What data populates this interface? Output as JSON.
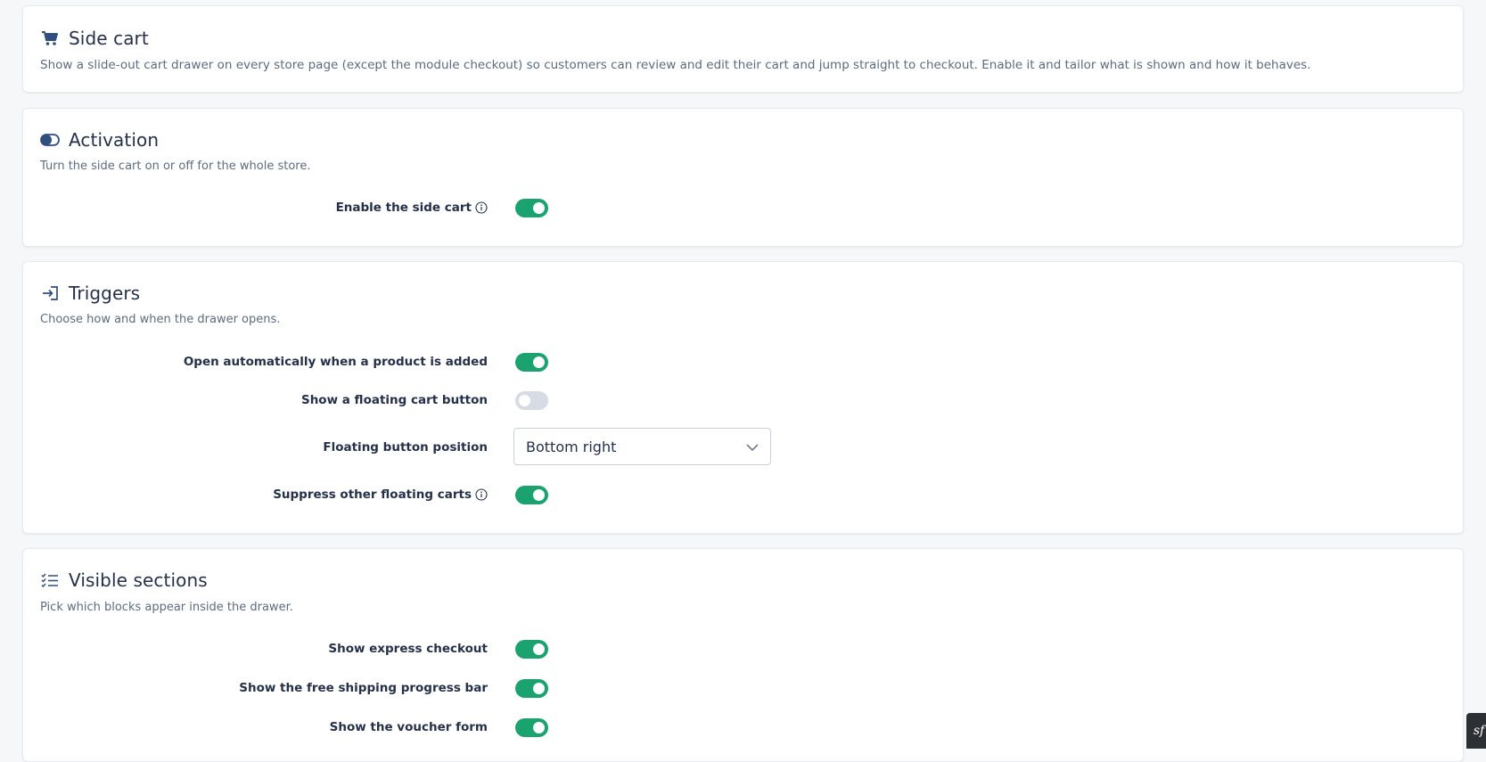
{
  "side_cart": {
    "title": "Side cart",
    "description": "Show a slide-out cart drawer on every store page (except the module checkout) so customers can review and edit their cart and jump straight to checkout. Enable it and tailor what is shown and how it behaves.",
    "icon": "cart-icon"
  },
  "activation": {
    "title": "Activation",
    "description": "Turn the side cart on or off for the whole store.",
    "icon": "toggle-icon",
    "enable_label": "Enable the side cart",
    "enable_value": true
  },
  "triggers": {
    "title": "Triggers",
    "description": "Choose how and when the drawer opens.",
    "icon": "sign-in-icon",
    "auto_open_label": "Open automatically when a product is added",
    "auto_open_value": true,
    "floating_button_label": "Show a floating cart button",
    "floating_button_value": false,
    "position_label": "Floating button position",
    "position_value": "Bottom right",
    "suppress_label": "Suppress other floating carts",
    "suppress_value": true
  },
  "visible_sections": {
    "title": "Visible sections",
    "description": "Pick which blocks appear inside the drawer.",
    "icon": "checklist-icon",
    "express_label": "Show express checkout",
    "express_value": true,
    "shipping_bar_label": "Show the free shipping progress bar",
    "shipping_bar_value": true,
    "voucher_label": "Show the voucher form",
    "voucher_value": true
  },
  "colors": {
    "accent": "#1aa36f",
    "toggle_off": "#d7dbe3",
    "icon": "#2f4f7f",
    "text": "#25304a"
  },
  "corner_badge": {
    "glyph": "sf",
    "icon": "symfony-icon"
  }
}
